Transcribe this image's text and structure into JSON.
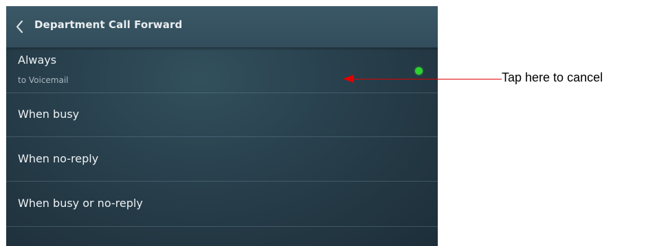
{
  "header": {
    "back_icon": "chevron-left-icon",
    "title": "Department Call Forward"
  },
  "options": [
    {
      "label": "Always",
      "sublabel": "to Voicemail",
      "active": true
    },
    {
      "label": "When busy"
    },
    {
      "label": "When no-reply"
    },
    {
      "label": "When busy or no-reply"
    }
  ],
  "annotation": {
    "text": "Tap here to cancel",
    "color": "#e00000"
  },
  "colors": {
    "active_indicator": "#2ed12e",
    "header_background": "#345060",
    "screen_background": "#283f4c"
  }
}
